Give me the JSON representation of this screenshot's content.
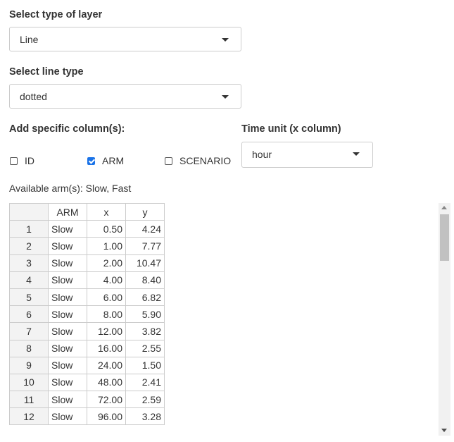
{
  "layer": {
    "label": "Select type of layer",
    "value": "Line"
  },
  "linetype": {
    "label": "Select line type",
    "value": "dotted"
  },
  "columns": {
    "label": "Add specific column(s):",
    "options": [
      {
        "label": "ID",
        "checked": false
      },
      {
        "label": "ARM",
        "checked": true
      },
      {
        "label": "SCENARIO",
        "checked": false
      }
    ]
  },
  "timeunit": {
    "label": "Time unit (x column)",
    "value": "hour"
  },
  "arms_info": "Available arm(s): Slow, Fast",
  "table": {
    "headers": [
      "",
      "ARM",
      "x",
      "y"
    ],
    "rows": [
      [
        "1",
        "Slow",
        "0.50",
        "4.24"
      ],
      [
        "2",
        "Slow",
        "1.00",
        "7.77"
      ],
      [
        "3",
        "Slow",
        "2.00",
        "10.47"
      ],
      [
        "4",
        "Slow",
        "4.00",
        "8.40"
      ],
      [
        "5",
        "Slow",
        "6.00",
        "6.82"
      ],
      [
        "6",
        "Slow",
        "8.00",
        "5.90"
      ],
      [
        "7",
        "Slow",
        "12.00",
        "3.82"
      ],
      [
        "8",
        "Slow",
        "16.00",
        "2.55"
      ],
      [
        "9",
        "Slow",
        "24.00",
        "1.50"
      ],
      [
        "10",
        "Slow",
        "48.00",
        "2.41"
      ],
      [
        "11",
        "Slow",
        "72.00",
        "2.59"
      ],
      [
        "12",
        "Slow",
        "96.00",
        "3.28"
      ]
    ]
  },
  "colors": {
    "checkbox_accent": "#1a73e8",
    "border": "#cccccc",
    "text": "#333333"
  }
}
